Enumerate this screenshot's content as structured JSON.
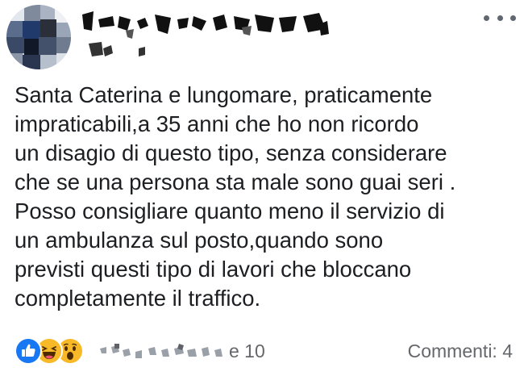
{
  "post": {
    "body_lines": [
      "Santa Caterina e lungomare, praticamente",
      "impraticabili,a 35 anni che ho non ricordo",
      "un disagio di questo tipo, senza considerare",
      "che se una persona sta male sono guai seri .",
      "Posso consigliare quanto meno il servizio di",
      "un ambulanza sul posto,quando sono",
      "previsti questi tipo di lavori che bloccano",
      "completamente il traffico."
    ],
    "reactions": {
      "icons": [
        "like-icon",
        "haha-icon",
        "wow-icon"
      ],
      "count_text": "e 10"
    },
    "comments_text": "Commenti: 4"
  },
  "colors": {
    "like": "#1877f2",
    "emoji": "#f7b928",
    "secondary_text": "#65676b"
  }
}
